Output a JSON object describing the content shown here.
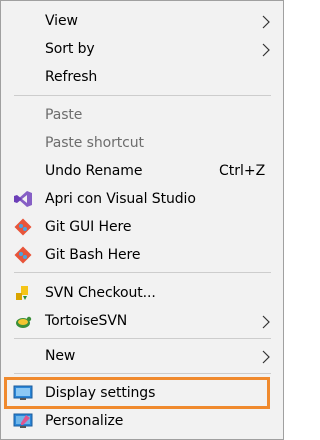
{
  "menu": {
    "items": [
      {
        "label": "View",
        "has_submenu": true
      },
      {
        "label": "Sort by",
        "has_submenu": true
      },
      {
        "label": "Refresh"
      },
      {
        "label": "Paste",
        "disabled": true
      },
      {
        "label": "Paste shortcut",
        "disabled": true
      },
      {
        "label": "Undo Rename",
        "shortcut": "Ctrl+Z"
      },
      {
        "label": "Apri con Visual Studio",
        "icon": "visual-studio-icon"
      },
      {
        "label": "Git GUI Here",
        "icon": "git-icon"
      },
      {
        "label": "Git Bash Here",
        "icon": "git-icon"
      },
      {
        "label": "SVN Checkout...",
        "icon": "svn-checkout-icon"
      },
      {
        "label": "TortoiseSVN",
        "icon": "tortoisesvn-icon",
        "has_submenu": true
      },
      {
        "label": "New",
        "has_submenu": true
      },
      {
        "label": "Display settings",
        "icon": "display-settings-icon",
        "highlighted": true
      },
      {
        "label": "Personalize",
        "icon": "personalize-icon"
      }
    ]
  },
  "colors": {
    "menu_background": "#f2f2f2",
    "disabled_text": "#6d6d6d",
    "separator": "#cdcdcd",
    "highlight_outline": "#f08a2e"
  }
}
